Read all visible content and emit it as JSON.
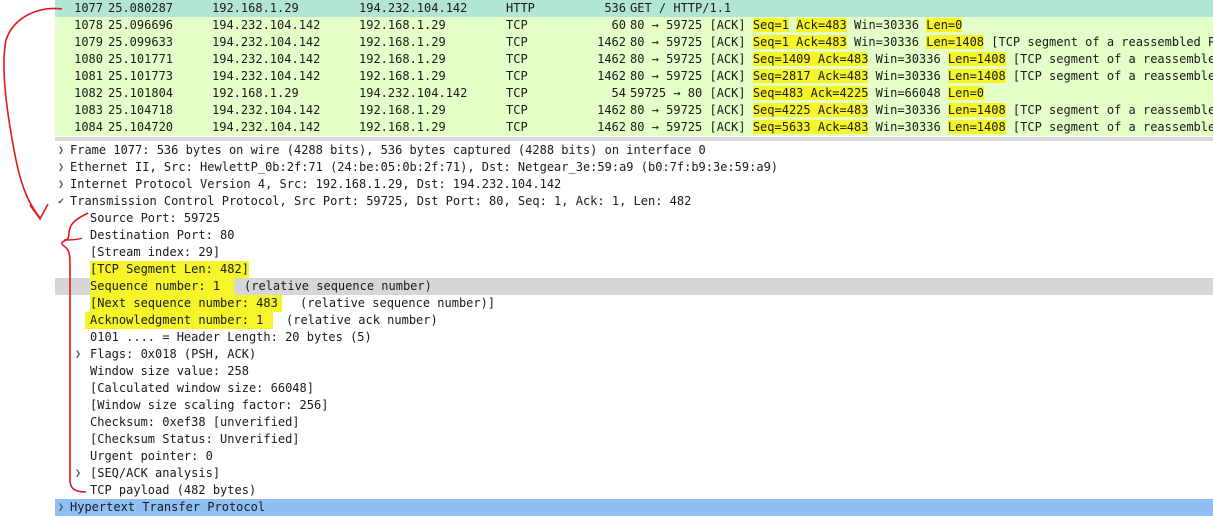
{
  "packets": [
    {
      "no": "1077",
      "time": "25.080287",
      "src": "192.168.1.29",
      "dst": "194.232.104.142",
      "proto": "HTTP",
      "len": "536",
      "type": "http",
      "info": [
        {
          "t": "GET / HTTP/1.1",
          "h": false
        }
      ]
    },
    {
      "no": "1078",
      "time": "25.096696",
      "src": "194.232.104.142",
      "dst": "192.168.1.29",
      "proto": "TCP",
      "len": "60",
      "type": "tcp",
      "info": [
        {
          "t": "80 → 59725 [ACK] ",
          "h": false
        },
        {
          "t": "Seq=1",
          "h": true
        },
        {
          "t": " ",
          "h": false
        },
        {
          "t": "Ack=483",
          "h": true
        },
        {
          "t": " Win=30336 ",
          "h": false
        },
        {
          "t": "Len=0",
          "h": true
        }
      ]
    },
    {
      "no": "1079",
      "time": "25.099633",
      "src": "194.232.104.142",
      "dst": "192.168.1.29",
      "proto": "TCP",
      "len": "1462",
      "type": "tcp",
      "info": [
        {
          "t": "80 → 59725 [ACK] ",
          "h": false
        },
        {
          "t": "Seq=1 Ack=483",
          "h": true
        },
        {
          "t": " Win=30336 ",
          "h": false
        },
        {
          "t": "Len=1408",
          "h": true
        },
        {
          "t": " [TCP segment of a reassembled PDU]",
          "h": false
        }
      ]
    },
    {
      "no": "1080",
      "time": "25.101771",
      "src": "194.232.104.142",
      "dst": "192.168.1.29",
      "proto": "TCP",
      "len": "1462",
      "type": "tcp",
      "info": [
        {
          "t": "80 → 59725 [ACK] ",
          "h": false
        },
        {
          "t": "Seq=1409 Ack=483",
          "h": true
        },
        {
          "t": " Win=30336 ",
          "h": false
        },
        {
          "t": "Len=1408",
          "h": true
        },
        {
          "t": " [TCP segment of a reassembled PDU]",
          "h": false
        }
      ]
    },
    {
      "no": "1081",
      "time": "25.101773",
      "src": "194.232.104.142",
      "dst": "192.168.1.29",
      "proto": "TCP",
      "len": "1462",
      "type": "tcp",
      "info": [
        {
          "t": "80 → 59725 [ACK] ",
          "h": false
        },
        {
          "t": "Seq=2817 Ack=483",
          "h": true
        },
        {
          "t": " Win=30336 ",
          "h": false
        },
        {
          "t": "Len=1408",
          "h": true
        },
        {
          "t": " [TCP segment of a reassembled PDU]",
          "h": false
        }
      ]
    },
    {
      "no": "1082",
      "time": "25.101804",
      "src": "192.168.1.29",
      "dst": "194.232.104.142",
      "proto": "TCP",
      "len": "54",
      "type": "tcp",
      "info": [
        {
          "t": "59725 → 80 [ACK] ",
          "h": false
        },
        {
          "t": "Seq=483 Ack=4225",
          "h": true
        },
        {
          "t": " Win=66048 ",
          "h": false
        },
        {
          "t": "Len=0",
          "h": true
        }
      ]
    },
    {
      "no": "1083",
      "time": "25.104718",
      "src": "194.232.104.142",
      "dst": "192.168.1.29",
      "proto": "TCP",
      "len": "1462",
      "type": "tcp",
      "info": [
        {
          "t": "80 → 59725 [ACK] ",
          "h": false
        },
        {
          "t": "Seq=4225 Ack=483",
          "h": true
        },
        {
          "t": " Win=30336 ",
          "h": false
        },
        {
          "t": "Len=1408",
          "h": true
        },
        {
          "t": " [TCP segment of a reassembled PDU]",
          "h": false
        }
      ]
    },
    {
      "no": "1084",
      "time": "25.104720",
      "src": "194.232.104.142",
      "dst": "192.168.1.29",
      "proto": "TCP",
      "len": "1462",
      "type": "tcp",
      "info": [
        {
          "t": "80 → 59725 [ACK] ",
          "h": false
        },
        {
          "t": "Seq=5633 Ack=483",
          "h": true
        },
        {
          "t": " Win=30336 ",
          "h": false
        },
        {
          "t": "Len=1408",
          "h": true
        },
        {
          "t": " [TCP segment of a reassembled PDU]",
          "h": false
        }
      ]
    }
  ],
  "details": {
    "frame": "Frame 1077: 536 bytes on wire (4288 bits), 536 bytes captured (4288 bits) on interface 0",
    "ethernet": "Ethernet II, Src: HewlettP_0b:2f:71 (24:be:05:0b:2f:71), Dst: Netgear_3e:59:a9 (b0:7f:b9:3e:59:a9)",
    "ip": "Internet Protocol Version 4, Src: 192.168.1.29, Dst: 194.232.104.142",
    "tcp": "Transmission Control Protocol, Src Port: 59725, Dst Port: 80, Seq: 1, Ack: 1, Len: 482",
    "source_port": "Source Port: 59725",
    "destination_port": "Destination Port: 80",
    "stream_index": "[Stream index: 29]",
    "segment_len": "[TCP Segment Len: 482]",
    "sequence_number": "Sequence number: 1",
    "sequence_number_note": "(relative sequence number)",
    "next_sequence_number": "[Next sequence number: 483",
    "next_sequence_number_note": "(relative sequence number)]",
    "ack_number": "Acknowledgment number: 1",
    "ack_number_note": "(relative ack number)",
    "header_length": "0101 .... = Header Length: 20 bytes (5)",
    "flags": "Flags: 0x018 (PSH, ACK)",
    "window_size": "Window size value: 258",
    "calc_window": "[Calculated window size: 66048]",
    "window_scaling": "[Window size scaling factor: 256]",
    "checksum": "Checksum: 0xef38 [unverified]",
    "checksum_status": "[Checksum Status: Unverified]",
    "urgent": "Urgent pointer: 0",
    "seq_ack_analysis": "[SEQ/ACK analysis]",
    "payload": "TCP payload (482 bytes)",
    "http": "Hypertext Transfer Protocol"
  },
  "colors": {
    "http_row": "#b2e5d6",
    "tcp_row": "#e4ffc7",
    "highlight": "#f5f52a",
    "selected": "#d6d6d6",
    "http_detail": "#8fc0f5",
    "annotation": "#e0191e"
  }
}
